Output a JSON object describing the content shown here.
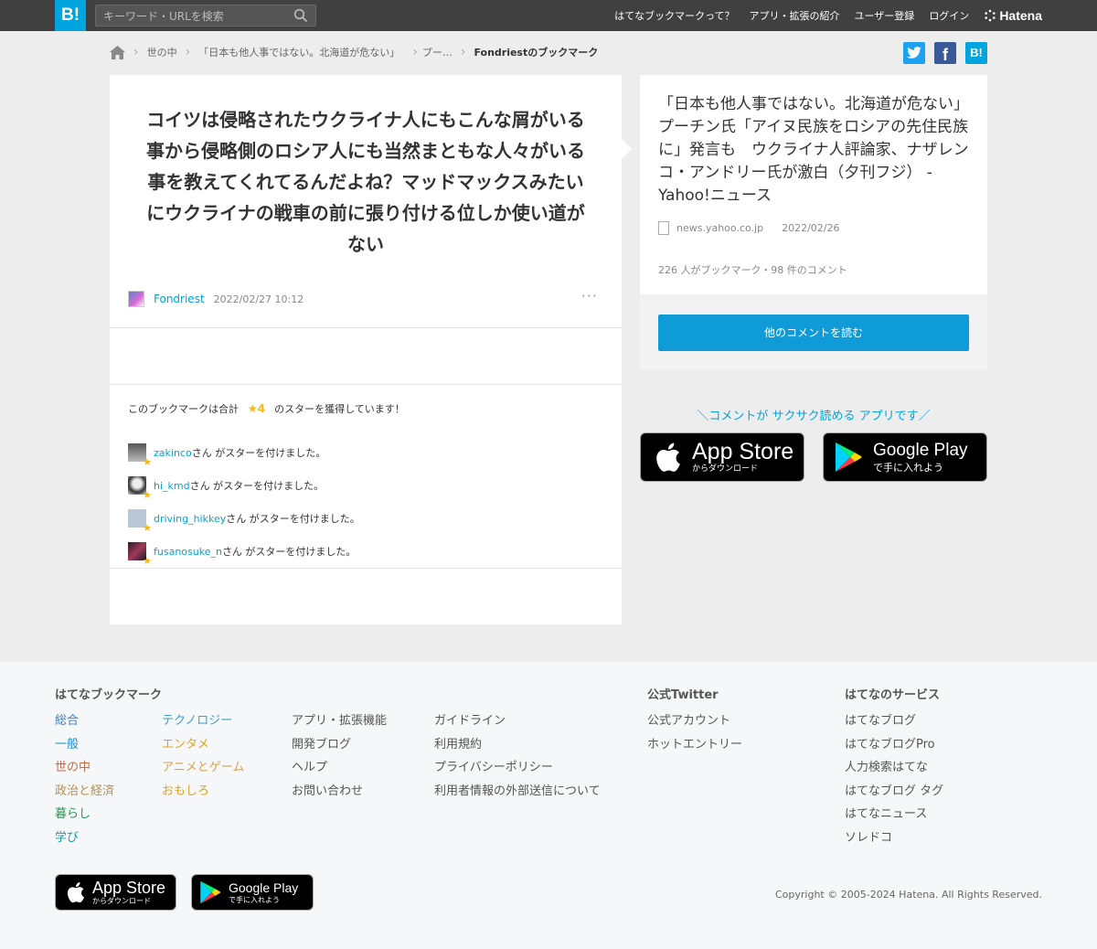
{
  "header": {
    "logo": "B!",
    "search_placeholder": "キーワード・URLを検索",
    "nav": [
      "はてなブックマークって？",
      "アプリ・拡張の紹介",
      "ユーザー登録",
      "ログイン"
    ],
    "brand": "Hatena"
  },
  "breadcrumb": {
    "items": [
      "世の中",
      "「日本も他人事ではない。北海道が危ない」",
      "プー…"
    ],
    "current": "Fondriestのブックマーク"
  },
  "bookmark": {
    "comment": "コイツは侵略されたウクライナ人にもこんな屑がいる事から侵略側のロシア人にも当然まともな人々がいる事を教えてくれてるんだよね？マッドマックスみたいにウクライナの戦車の前に張り付ける位しか使い道がない",
    "user": "Fondriest",
    "date": "2022/02/27 10:12",
    "more": "···"
  },
  "stars": {
    "title_prefix": "このブックマークは合計",
    "total": "★4",
    "title_suffix": "のスターを獲得しています！",
    "suffix": "さん がスターを付けました。",
    "users": [
      "zakinco",
      "hi_kmd",
      "driving_hikkey",
      "fusanosuke_n"
    ]
  },
  "entry": {
    "title": "「日本も他人事ではない。北海道が危ない」　プーチン氏「アイヌ民族をロシアの先住民族に」発言も　ウクライナ人評論家、ナザレンコ・アンドリー氏が激白（夕刊フジ） - Yahoo!ニュース",
    "domain": "news.yahoo.co.jp",
    "date": "2022/02/26",
    "stats": "226 人がブックマーク・98 件のコメント",
    "read_button": "他のコメントを読む"
  },
  "app_promo": {
    "text": "＼コメントが サクサク読める アプリです／",
    "appstore_big": "App Store",
    "appstore_small": "からダウンロード",
    "googleplay_big": "Google Play",
    "googleplay_small": "で手に入れよう"
  },
  "footer": {
    "bookmark_title": "はてなブックマーク",
    "categories_col1": [
      "総合",
      "一般",
      "世の中",
      "政治と経済",
      "暮らし",
      "学び"
    ],
    "categories_col2": [
      "テクノロジー",
      "エンタメ",
      "アニメとゲーム",
      "おもしろ"
    ],
    "links_col3": [
      "アプリ・拡張機能",
      "開発ブログ",
      "ヘルプ",
      "お問い合わせ"
    ],
    "links_col4": [
      "ガイドライン",
      "利用規約",
      "プライバシーポリシー",
      "利用者情報の外部送信について"
    ],
    "twitter_title": "公式Twitter",
    "twitter_links": [
      "公式アカウント",
      "ホットエントリー"
    ],
    "services_title": "はてなのサービス",
    "services": [
      "はてなブログ",
      "はてなブログPro",
      "人力検索はてな",
      "はてなブログ タグ",
      "はてなニュース",
      "ソレドコ"
    ],
    "copyright": "Copyright © 2005-2024 Hatena. All Rights Reserved."
  },
  "colors": {
    "accent": "#00a4de",
    "star": "#f5b618",
    "topbar": "#404040",
    "cat_total": "#3d7ec9",
    "cat_general": "#1d8dd5",
    "cat_world": "#c36c42",
    "cat_politics": "#b68e4f",
    "cat_life": "#2a9356",
    "cat_knowledge": "#1a9e9e",
    "cat_tech": "#3d9ed4",
    "cat_entertainment": "#e4a31f",
    "cat_game": "#d9a34b",
    "cat_fun": "#e0a11c"
  }
}
